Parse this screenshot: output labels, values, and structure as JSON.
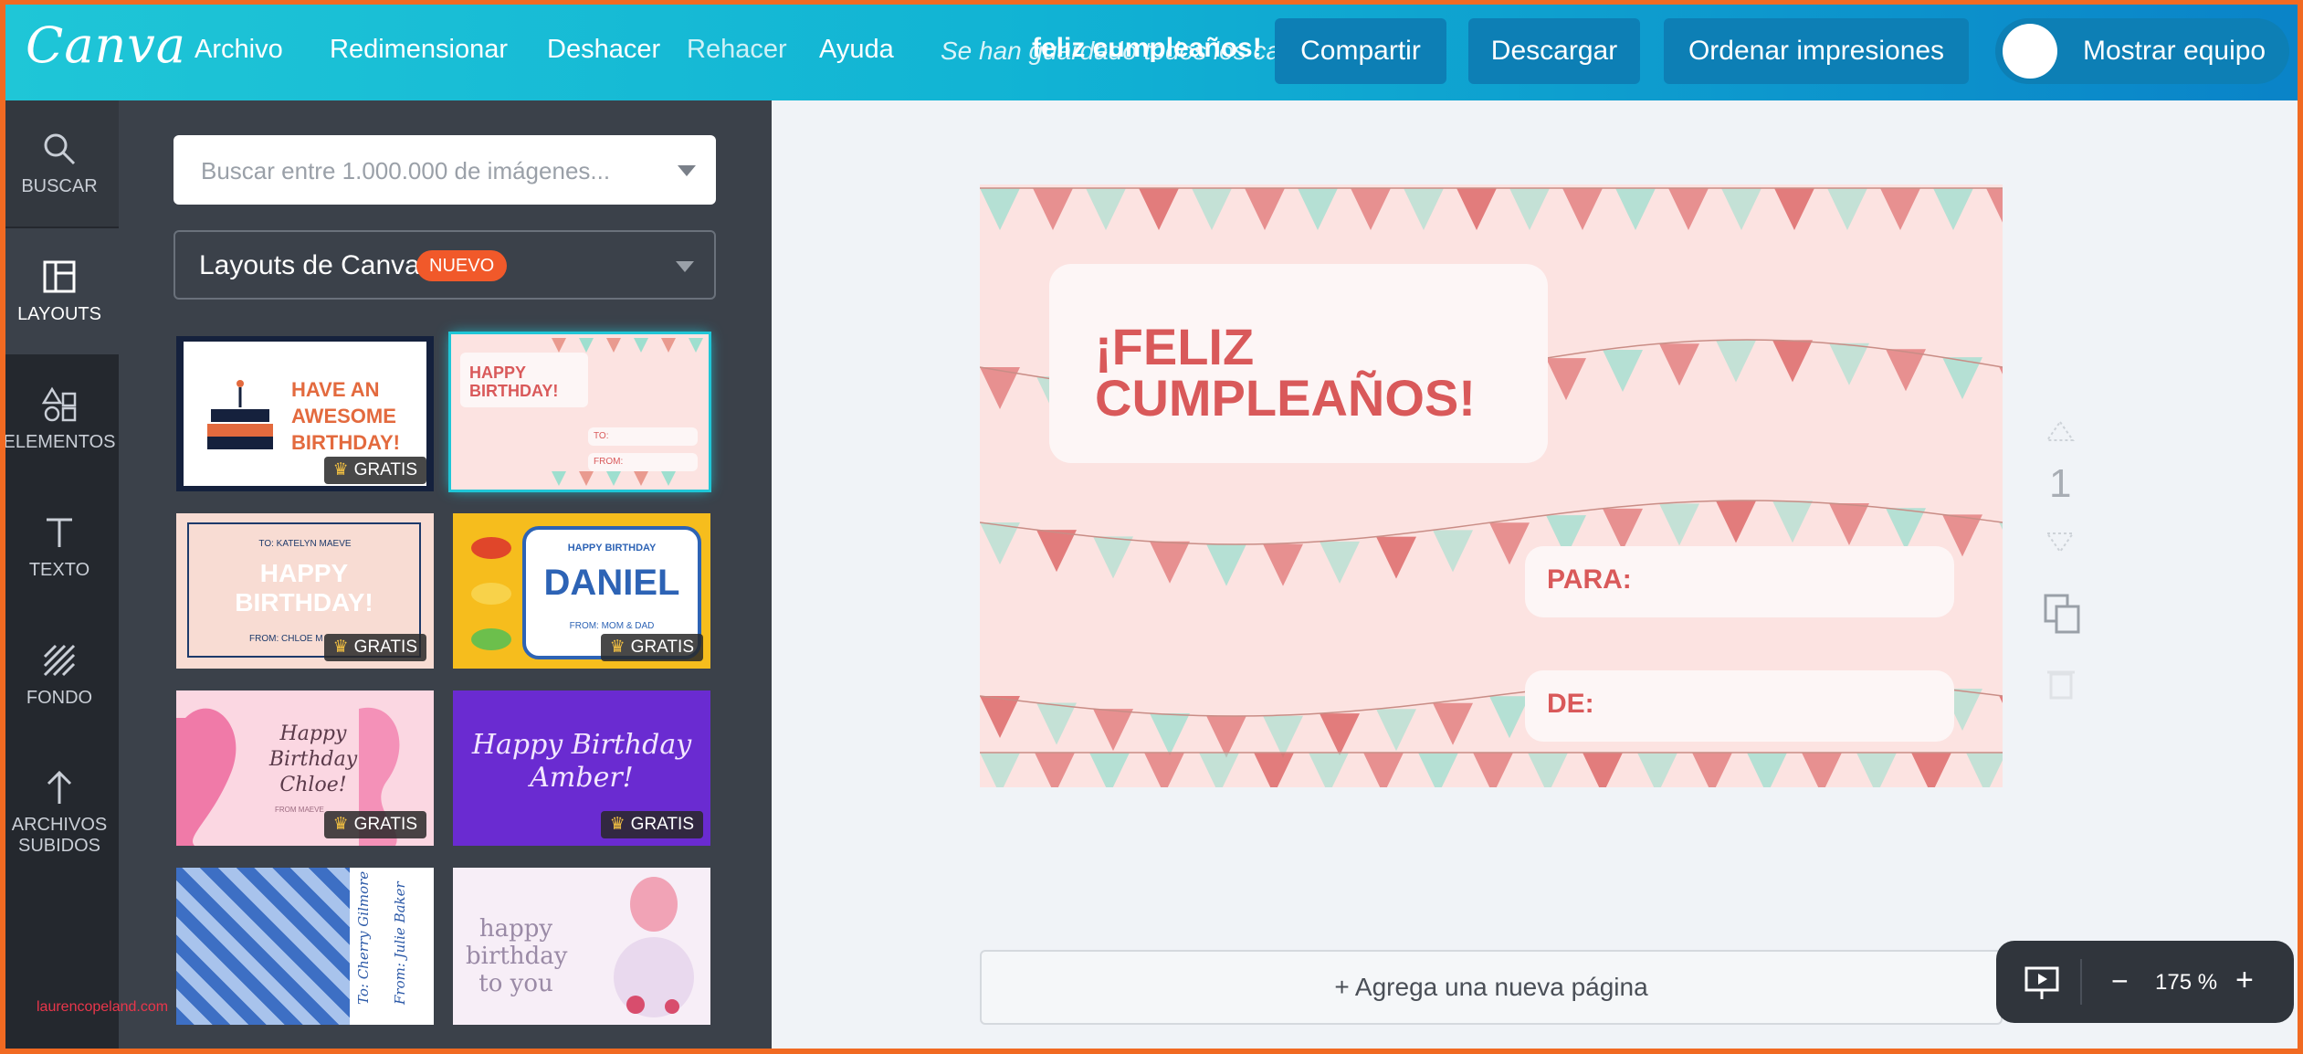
{
  "topbar": {
    "logo": "Canva",
    "menu": [
      "Archivo",
      "Redimensionar",
      "Deshacer",
      "Rehacer",
      "Ayuda"
    ],
    "saved_status": "Se han guardado todos los cambios",
    "doc_title": "feliz cumpleaños!",
    "share": "Compartir",
    "download": "Descargar",
    "order_prints": "Ordenar impresiones",
    "show_team": "Mostrar equipo"
  },
  "rail": [
    {
      "label": "BUSCAR",
      "icon": "search-icon"
    },
    {
      "label": "LAYOUTS",
      "icon": "layouts-icon"
    },
    {
      "label": "ELEMENTOS",
      "icon": "elements-icon"
    },
    {
      "label": "TEXTO",
      "icon": "text-icon"
    },
    {
      "label": "FONDO",
      "icon": "background-icon"
    },
    {
      "label": "ARCHIVOS SUBIDOS",
      "icon": "upload-icon"
    }
  ],
  "panel": {
    "search_placeholder": "Buscar entre 1.000.000 de imágenes...",
    "layouts_label": "Layouts de Canva",
    "new_badge": "NUEVO",
    "free_badge": "GRATIS",
    "thumbs": [
      {
        "text": "HAVE AN AWESOME BIRTHDAY!",
        "free": true
      },
      {
        "text": "HAPPY BIRTHDAY!",
        "to": "TO:",
        "from": "FROM:",
        "free": false
      },
      {
        "text": "HAPPY BIRTHDAY!",
        "to": "TO: KATELYN MAEVE",
        "from": "FROM: CHLOE M",
        "free": true
      },
      {
        "text": "DANIEL",
        "top": "HAPPY BIRTHDAY",
        "from": "FROM: MOM & DAD",
        "free": true
      },
      {
        "text": "Happy Birthday Chloe!",
        "from": "FROM MAEVE",
        "free": true
      },
      {
        "text": "Happy Birthday Amber!",
        "free": true
      },
      {
        "text": "To: Cherry Gilmore",
        "from": "From: Julie Baker",
        "free": false
      },
      {
        "text": "happy birthday to you",
        "free": false
      }
    ],
    "watermark": "laurencopeland.com"
  },
  "card": {
    "heading": "¡FELIZ CUMPLEAÑOS!",
    "para": "PARA:",
    "de": "DE:"
  },
  "page_number": "1",
  "add_page": "+ Agrega una nueva página",
  "zoom": "175 %",
  "colors": {
    "accent": "#1fc6d7",
    "brand_dark": "#0a83c8",
    "card_bg": "#fce3e1",
    "coral": "#d9595a",
    "mint": "#9edfcf"
  }
}
